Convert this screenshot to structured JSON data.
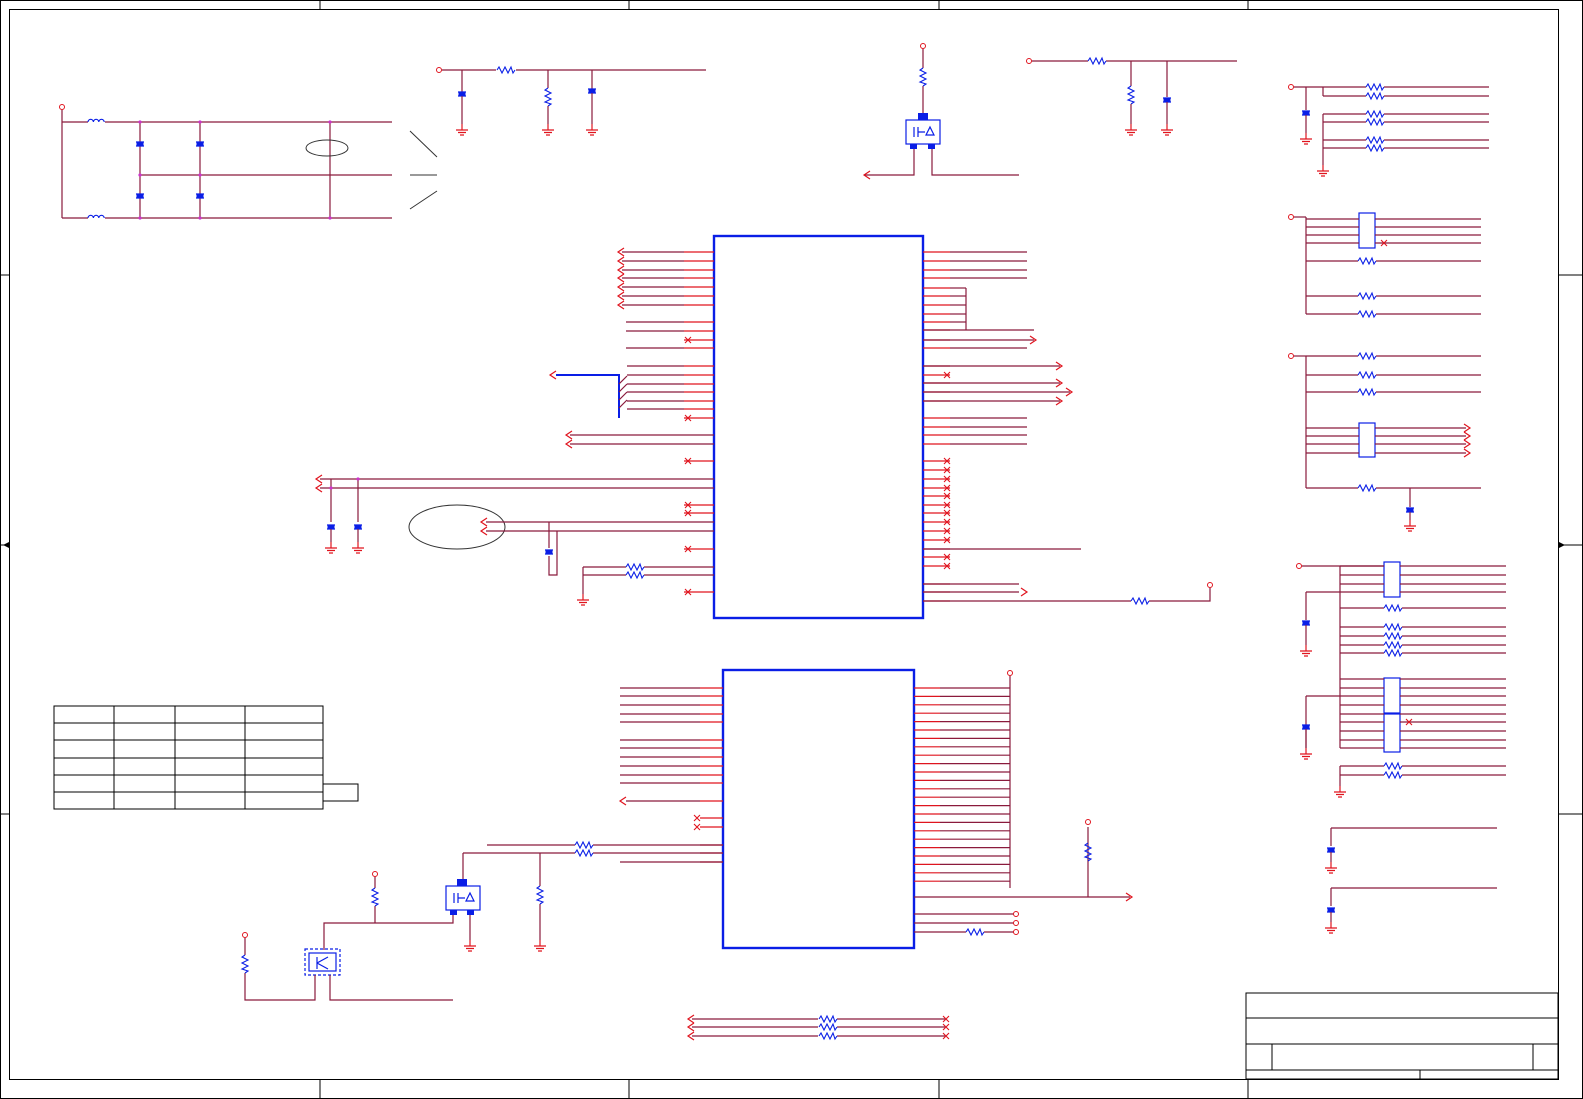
{
  "title_block": {},
  "table": {
    "rows": 6,
    "cols": 4
  }
}
